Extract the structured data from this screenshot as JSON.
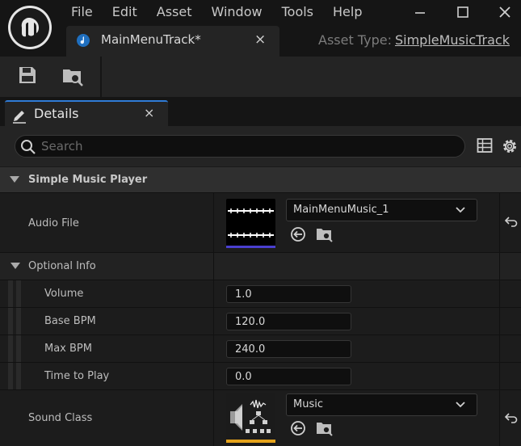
{
  "menu": [
    "File",
    "Edit",
    "Asset",
    "Window",
    "Tools",
    "Help"
  ],
  "window_controls": {
    "minimize": "minimize-icon",
    "maximize": "maximize-icon",
    "close": "close-icon"
  },
  "asset_tab": {
    "label": "MainMenuTrack*",
    "close": "×"
  },
  "asset_type": {
    "label": "Asset Type:",
    "value": "SimpleMusicTrack"
  },
  "toolbar": {
    "save": "save-icon",
    "browse": "browse-asset-icon"
  },
  "details": {
    "tab_label": "Details",
    "close": "×",
    "search_placeholder": "Search"
  },
  "categories": {
    "simple_music_player": "Simple Music Player",
    "optional_info": "Optional Info"
  },
  "properties": {
    "audio_file": {
      "label": "Audio File",
      "value": "MainMenuMusic_1"
    },
    "volume": {
      "label": "Volume",
      "value": "1.0"
    },
    "base_bpm": {
      "label": "Base BPM",
      "value": "120.0"
    },
    "max_bpm": {
      "label": "Max BPM",
      "value": "240.0"
    },
    "time_to_play": {
      "label": "Time to Play",
      "value": "0.0"
    },
    "sound_class": {
      "label": "Sound Class",
      "value": "Music"
    }
  },
  "colors": {
    "accent_blue": "#2f7bd6",
    "sound_class_underline": "#e5a31b",
    "audio_underline": "#4a3fd0"
  }
}
